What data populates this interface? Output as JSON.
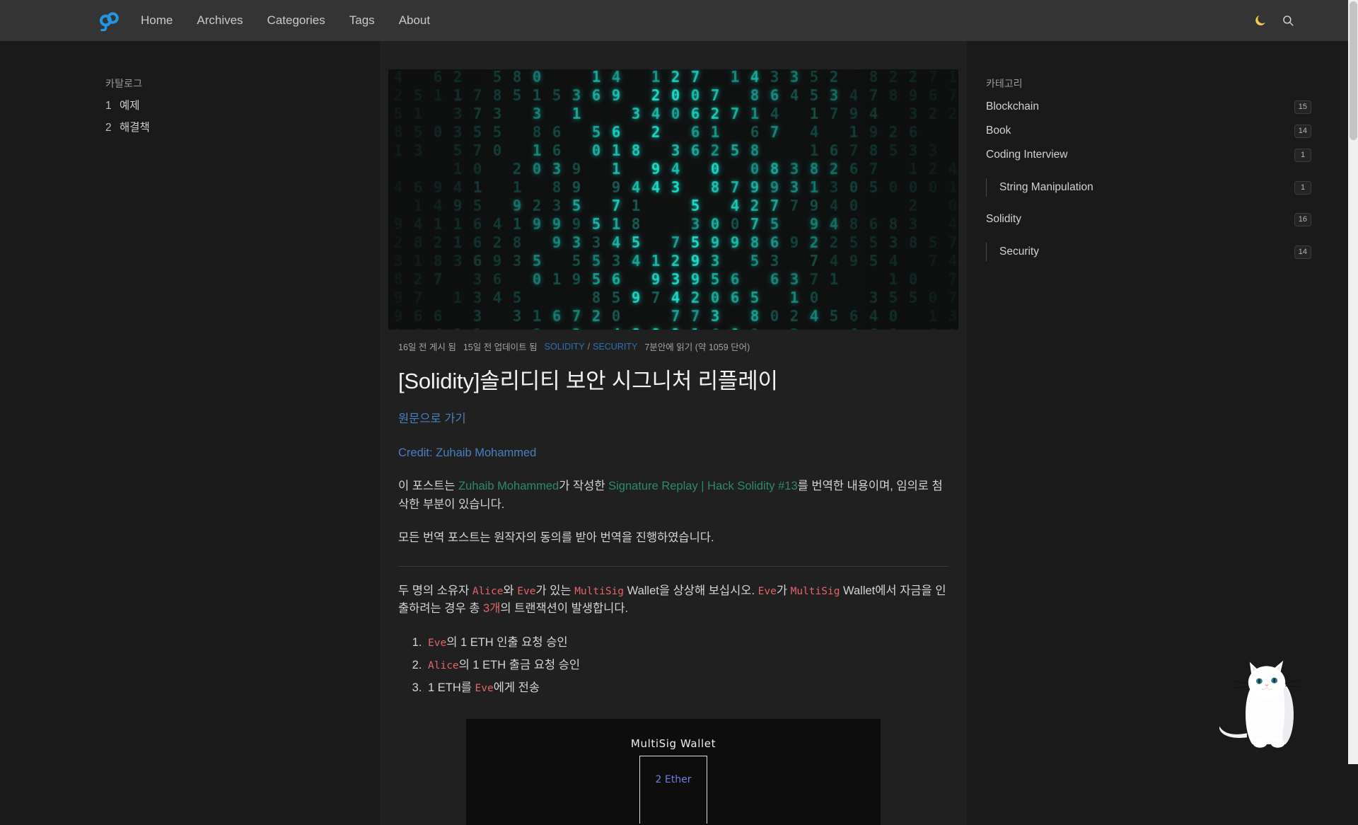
{
  "nav": {
    "logo_alt": "go-logo",
    "links": [
      {
        "label": "Home"
      },
      {
        "label": "Archives"
      },
      {
        "label": "Categories"
      },
      {
        "label": "Tags"
      },
      {
        "label": "About"
      }
    ],
    "theme_toggle": "moon-icon",
    "search": "search-icon"
  },
  "toc": {
    "title": "카탈로그",
    "items": [
      {
        "num": "1",
        "label": "예제"
      },
      {
        "num": "2",
        "label": "해결책"
      }
    ]
  },
  "post": {
    "meta": {
      "published": "16일 전 게시 됨",
      "updated": "15일 전 업데이트 됨",
      "category": "SOLIDITY",
      "slash": "/",
      "subcategory": "SECURITY",
      "reading_time": "7분안에 읽기 (약 1059 단어)"
    },
    "title": "[Solidity]솔리디티 보안 시그니처 리플레이",
    "source_link": "원문으로 가기",
    "credit": "Credit: Zuhaib Mohammed",
    "intro_1_a": "이 포스트는 ",
    "intro_1_author": "Zuhaib Mohammed",
    "intro_1_b": "가 작성한 ",
    "intro_1_article": "Signature Replay | Hack Solidity #13",
    "intro_1_c": "를 번역한 내용이며, 임의로 첨삭한 부분이 있습니다.",
    "intro_2": "모든 번역 포스트는 원작자의 동의를 받아 번역을 진행하였습니다.",
    "body_1_a": "두 명의 소유자 ",
    "body_1_alice": "Alice",
    "body_1_b": "와 ",
    "body_1_eve": "Eve",
    "body_1_c": "가 있는 ",
    "body_1_multisig": "MultiSig",
    "body_1_d": " Wallet을 상상해 보십시오. ",
    "body_1_eve2": "Eve",
    "body_1_e": "가 ",
    "body_1_multisig2": "MultiSig",
    "body_1_f": " Wallet에서 자금을 인출하려는 경우 총 ",
    "body_1_count": "3개",
    "body_1_g": "의 트랜잭션이 발생합니다.",
    "steps": [
      {
        "code": "Eve",
        "text": "의 1 ETH 인출 요청 승인"
      },
      {
        "code": "Alice",
        "text": "의 1 ETH 출금 요청 승인"
      },
      {
        "pre": "1 ETH를 ",
        "code": "Eve",
        "text": "에게 전송"
      }
    ],
    "figure": {
      "title": "MultiSig Wallet",
      "amount": "2 Ether"
    }
  },
  "categories": {
    "title": "카테고리",
    "items": [
      {
        "label": "Blockchain",
        "count": "15",
        "nested": false
      },
      {
        "label": "Book",
        "count": "14",
        "nested": false
      },
      {
        "label": "Coding Interview",
        "count": "1",
        "nested": false
      },
      {
        "label": "String Manipulation",
        "count": "1",
        "nested": true
      },
      {
        "label": "Solidity",
        "count": "16",
        "nested": false
      },
      {
        "label": "Security",
        "count": "14",
        "nested": true
      }
    ]
  },
  "colors": {
    "page_bg": "#1a1a1a",
    "content_bg": "#202020",
    "nav_bg": "#343434",
    "accent_blue": "#4a7fc1",
    "accent_green": "#2e8b62",
    "code_red": "#e2656a",
    "meta_blue": "#2f6fb5",
    "moon_yellow": "#f2c94c",
    "matrix_cyan": "#1de9d4"
  },
  "mascot": {
    "name": "white-cat"
  }
}
